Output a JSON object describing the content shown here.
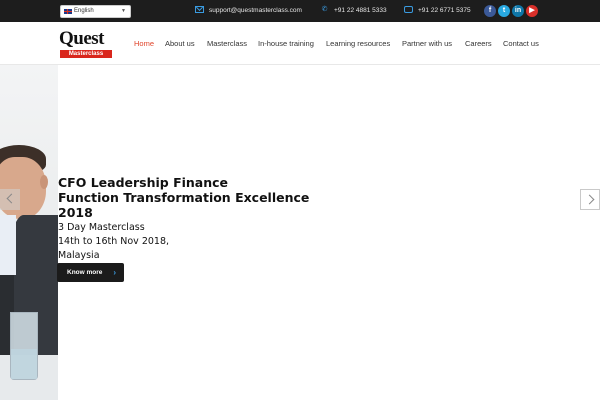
{
  "topbar": {
    "language": "English",
    "email": "support@questmasterclass.com",
    "phone": "+91 22 4881 5333",
    "fax": "+91 22 6771 5375",
    "social": [
      {
        "name": "facebook",
        "glyph": "f",
        "color": "#3b5998"
      },
      {
        "name": "twitter",
        "glyph": "t",
        "color": "#29a9e1"
      },
      {
        "name": "linkedin",
        "glyph": "in",
        "color": "#0e76a8"
      },
      {
        "name": "youtube",
        "glyph": "▶",
        "color": "#d9302a"
      }
    ]
  },
  "logo": {
    "main": "Quest",
    "sub": "Masterclass"
  },
  "nav": [
    "Home",
    "About us",
    "Masterclass",
    "In-house training",
    "Learning resources",
    "Partner with us",
    "Careers",
    "Contact us"
  ],
  "nav_active": "Home",
  "slide": {
    "title_lines": [
      "CFO Leadership Finance",
      "Function Transformation Excellence",
      "2018"
    ],
    "subtitle_lines": [
      "3 Day Masterclass",
      "14th to 16th Nov 2018,",
      "Malaysia"
    ],
    "cta": "Know more"
  },
  "colors": {
    "accent": "#e0452b",
    "topbar": "#1d1d1d",
    "icon_blue": "#3a9be0",
    "logo_red": "#d9261c"
  }
}
